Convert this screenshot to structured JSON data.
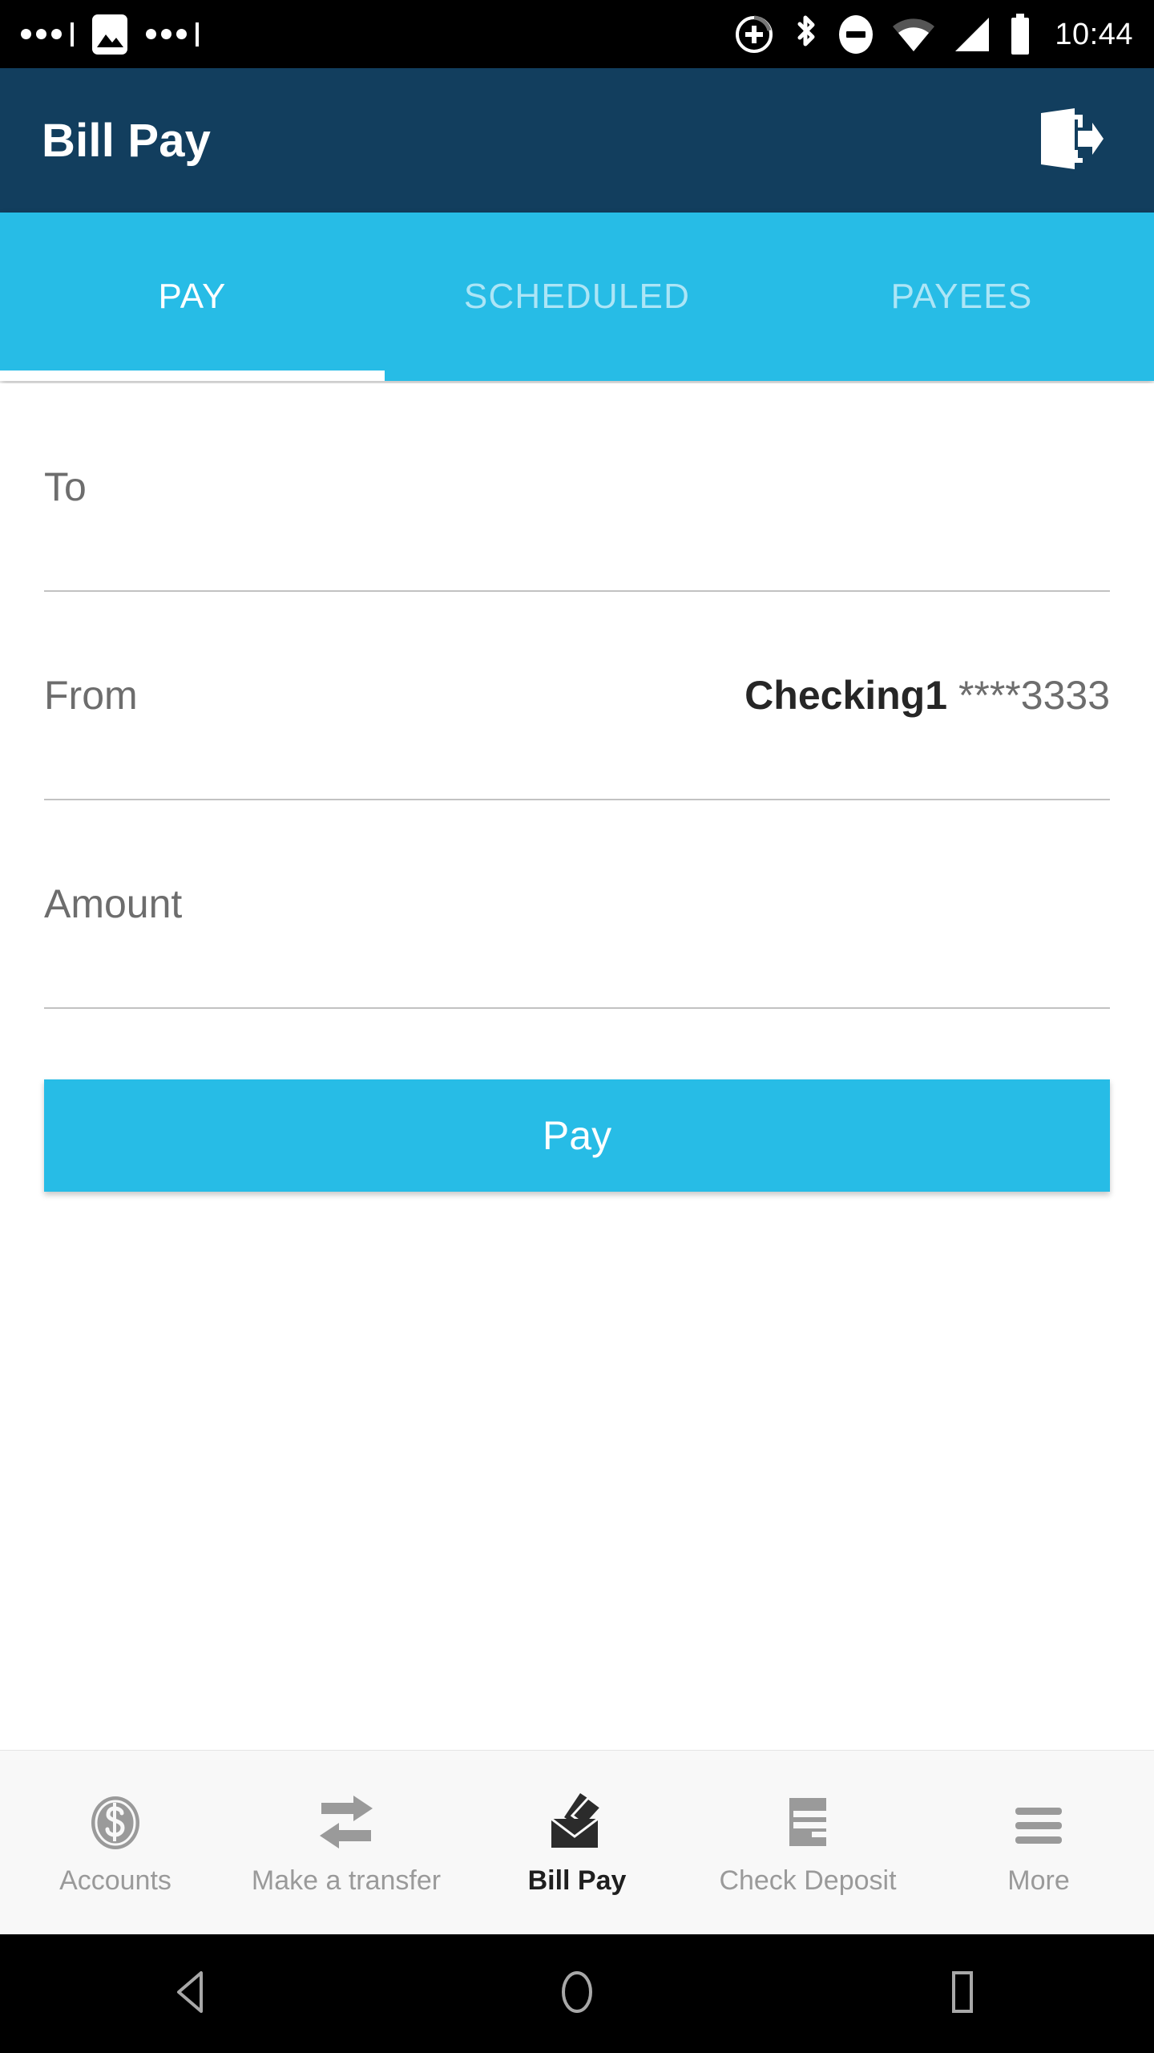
{
  "statusbar": {
    "time": "10:44",
    "left_icons": [
      "dots-indicator",
      "image-notification-icon",
      "dots-indicator"
    ],
    "right_icons": [
      "cast-plus-icon",
      "bluetooth-icon",
      "do-not-disturb-icon",
      "wifi-icon",
      "cellular-signal-icon",
      "battery-icon"
    ]
  },
  "appbar": {
    "title": "Bill Pay",
    "logout_icon": "logout-door-arrow-icon",
    "background": "#123E5E"
  },
  "tabs": {
    "accent": "#27BCE6",
    "active_index": 0,
    "items": [
      {
        "label": "PAY"
      },
      {
        "label": "SCHEDULED"
      },
      {
        "label": "PAYEES"
      }
    ]
  },
  "form": {
    "to": {
      "label": "To",
      "value": "",
      "placeholder": "To"
    },
    "from": {
      "label": "From",
      "account_name": "Checking1",
      "account_mask": "****3333",
      "value": "Checking1 ****3333"
    },
    "amount": {
      "label": "Amount",
      "value": "",
      "placeholder": "Amount"
    },
    "submit_label": "Pay"
  },
  "bottomnav": {
    "active_index": 2,
    "items": [
      {
        "label": "Accounts",
        "icon": "dollar-coin-icon"
      },
      {
        "label": "Make a transfer",
        "icon": "transfer-arrows-icon"
      },
      {
        "label": "Bill Pay",
        "icon": "open-envelope-icon"
      },
      {
        "label": "Check Deposit",
        "icon": "check-card-icon"
      },
      {
        "label": "More",
        "icon": "hamburger-menu-icon"
      }
    ]
  },
  "androidnav": {
    "back": "back-triangle-icon",
    "home": "home-circle-icon",
    "recents": "recents-square-icon"
  }
}
